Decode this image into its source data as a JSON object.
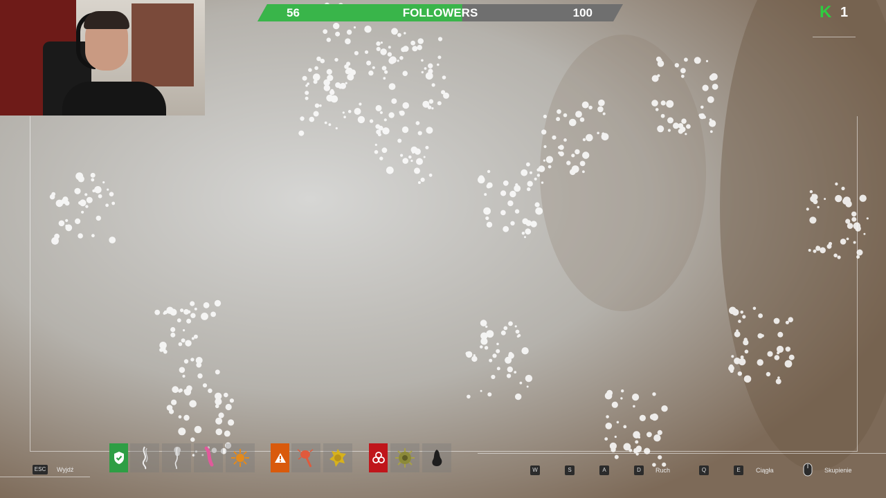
{
  "followers": {
    "current": "56",
    "label": "FOLLOWERS",
    "max": "100",
    "progress": 0.56,
    "fill_color": "#39b54a"
  },
  "top_right": {
    "badge": "K",
    "count": "1",
    "badge_color": "#2ecc40"
  },
  "bottom_left": {
    "key": "ESC",
    "label": "Wyjdź"
  },
  "toolbar": {
    "slots": [
      {
        "icon": "shield-check-icon",
        "bg": "#2e9e44"
      },
      {
        "icon": "flagella-icon"
      },
      {
        "icon": "cilia-icon"
      },
      {
        "icon": "pink-flagellum-icon"
      },
      {
        "icon": "burst-icon"
      },
      {
        "icon": "warning-icon",
        "bg": "#d95a0c"
      },
      {
        "icon": "red-bacterium-icon"
      },
      {
        "icon": "yellow-cell-icon"
      },
      {
        "icon": "biohazard-icon",
        "bg": "#c0161b"
      },
      {
        "icon": "spiky-spore-icon"
      },
      {
        "icon": "dark-organism-icon"
      }
    ]
  },
  "controls": {
    "keys": [
      "W",
      "S",
      "A",
      "D"
    ],
    "move_label": "Ruch",
    "key_q": "Q",
    "key_e": "E",
    "pull_label": "Ciągła",
    "mouse_label": "Skupienie"
  }
}
